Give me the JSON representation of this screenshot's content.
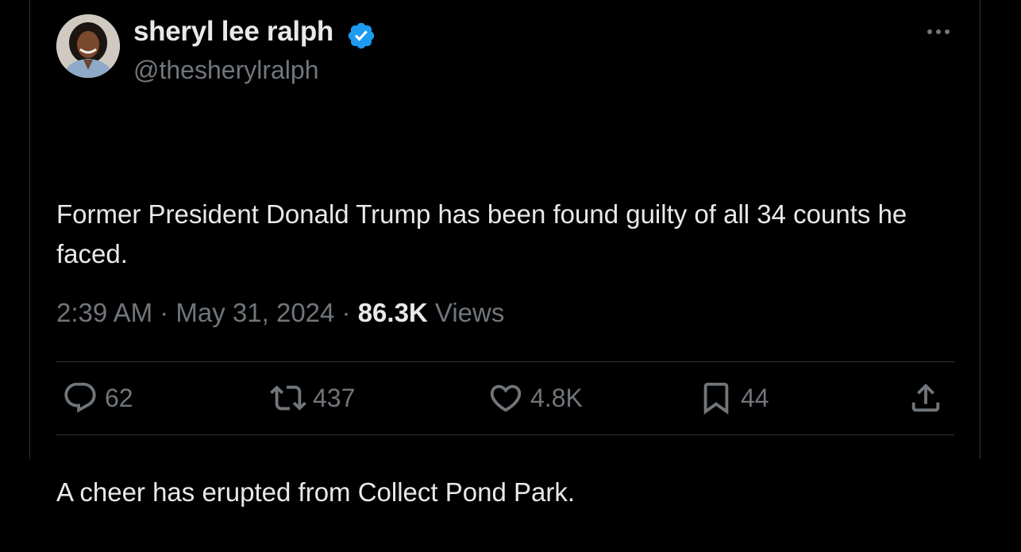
{
  "author": {
    "name": "sheryl lee ralph",
    "handle": "@thesherylralph",
    "verified": true
  },
  "post": {
    "line1": "Former President Donald Trump has been found guilty of all 34 counts he faced.",
    "line2": "A cheer has erupted from Collect Pond Park."
  },
  "meta": {
    "time": "2:39 AM",
    "sep1": " · ",
    "date": "May 31, 2024",
    "sep2": " · ",
    "views_count": "86.3K",
    "views_label": " Views"
  },
  "actions": {
    "replies": "62",
    "reposts": "437",
    "likes": "4.8K",
    "bookmarks": "44"
  },
  "colors": {
    "background": "#000000",
    "text": "#e7e9ea",
    "muted": "#71767b",
    "verified": "#1d9bf0",
    "divider": "#2f3336"
  },
  "icons": {
    "verified": "verified-badge-icon",
    "more": "more-horizontal-icon",
    "reply": "reply-icon",
    "repost": "repost-icon",
    "like": "heart-icon",
    "bookmark": "bookmark-icon",
    "share": "share-icon"
  }
}
